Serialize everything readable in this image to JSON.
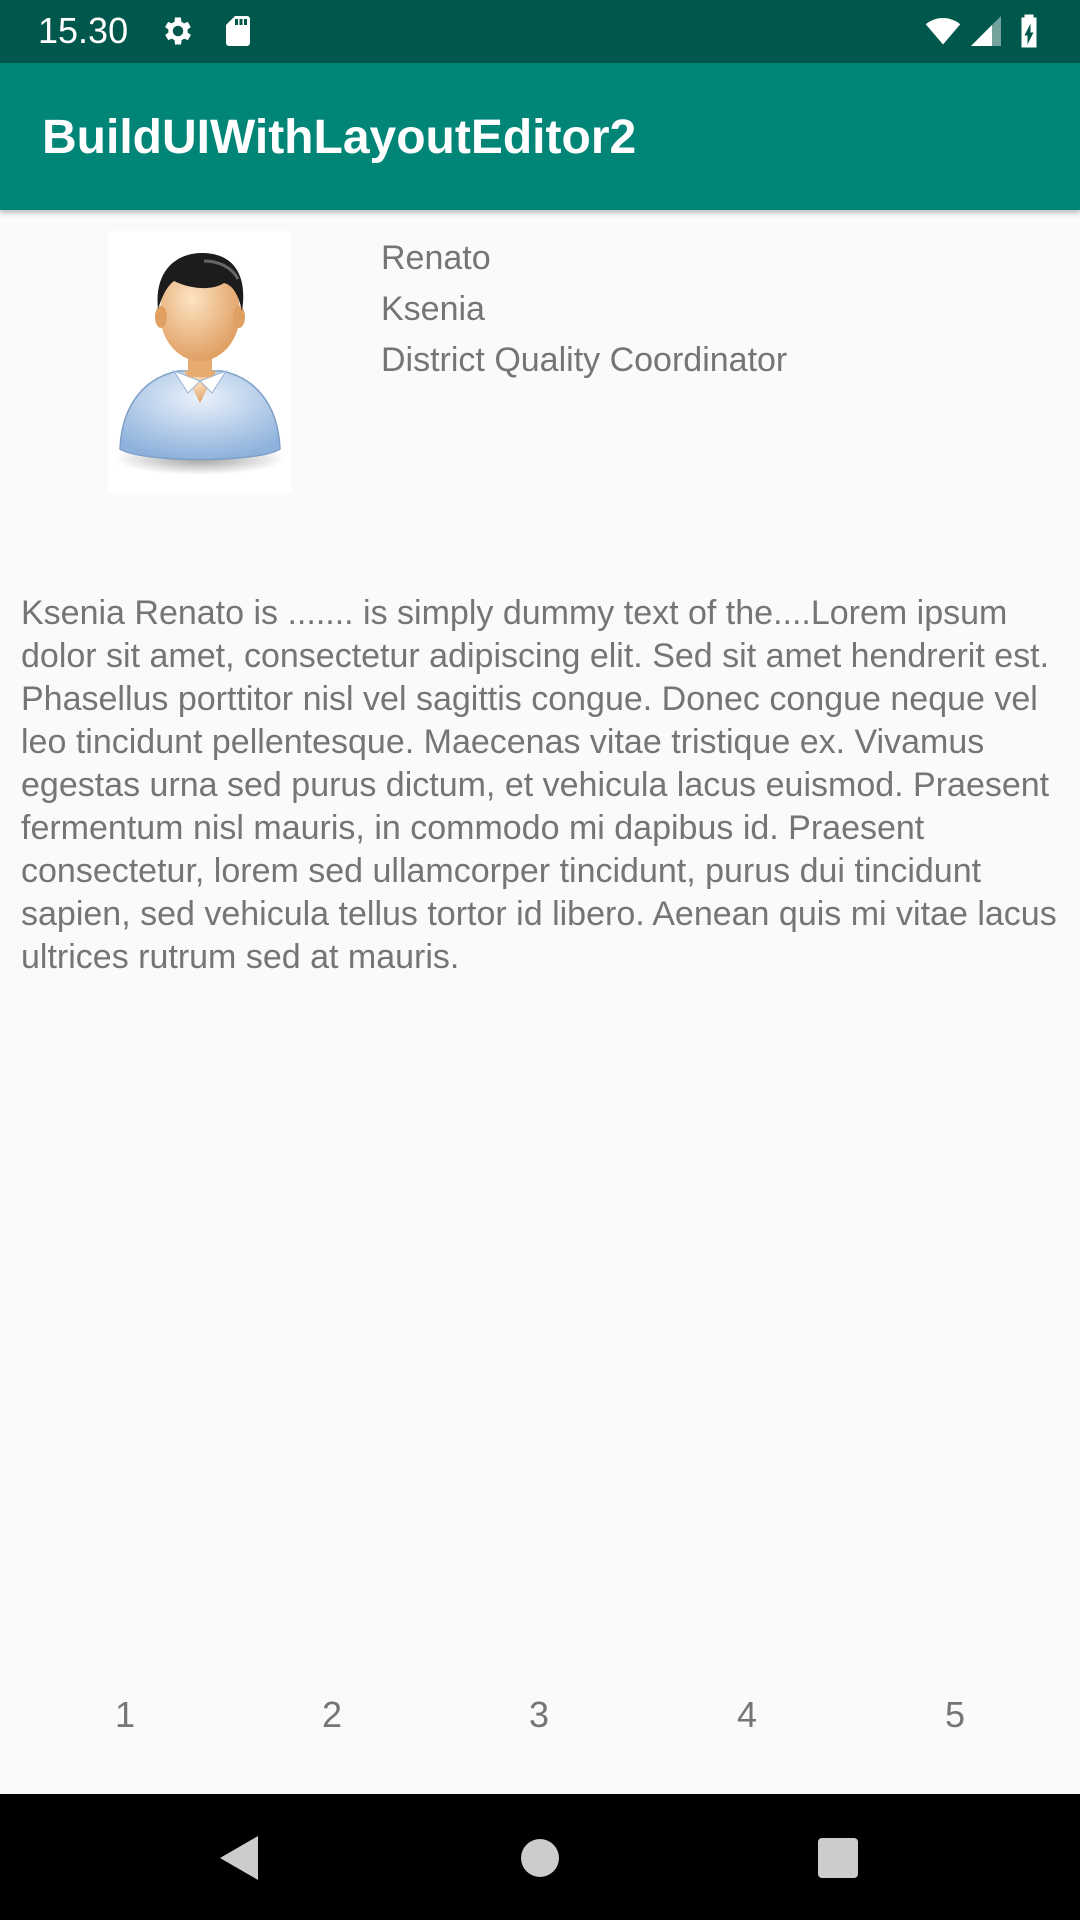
{
  "status_bar": {
    "time": "15.30",
    "left_icons": [
      "gear-icon",
      "sd-card-icon"
    ],
    "right_icons": [
      "wifi-icon",
      "signal-icon",
      "battery-charging-icon"
    ],
    "background": "#00574b"
  },
  "app_bar": {
    "title": "BuildUIWithLayoutEditor2",
    "background": "#008577"
  },
  "profile": {
    "avatar_icon": "person-avatar-icon",
    "first_name": "Renato",
    "last_name": "Ksenia",
    "title": "District Quality Coordinator"
  },
  "bio": {
    "text": "Ksenia Renato is ....... is simply dummy text of the....Lorem ipsum dolor sit amet, consectetur adipiscing elit. Sed sit amet hendrerit est. Phasellus porttitor nisl vel sagittis congue. Donec congue neque vel leo tincidunt pellentesque. Maecenas vitae tristique ex. Vivamus egestas urna sed purus dictum, et vehicula lacus euismod. Praesent fermentum nisl mauris, in commodo mi dapibus id. Praesent consectetur, lorem sed ullamcorper tincidunt, purus dui tincidunt sapien, sed vehicula tellus tortor id libero. Aenean quis mi vitae lacus ultrices rutrum sed at mauris."
  },
  "rating_row": {
    "items": [
      "1",
      "2",
      "3",
      "4",
      "5"
    ]
  },
  "nav_bar": {
    "buttons": [
      "back-icon",
      "home-icon",
      "recents-icon"
    ]
  }
}
